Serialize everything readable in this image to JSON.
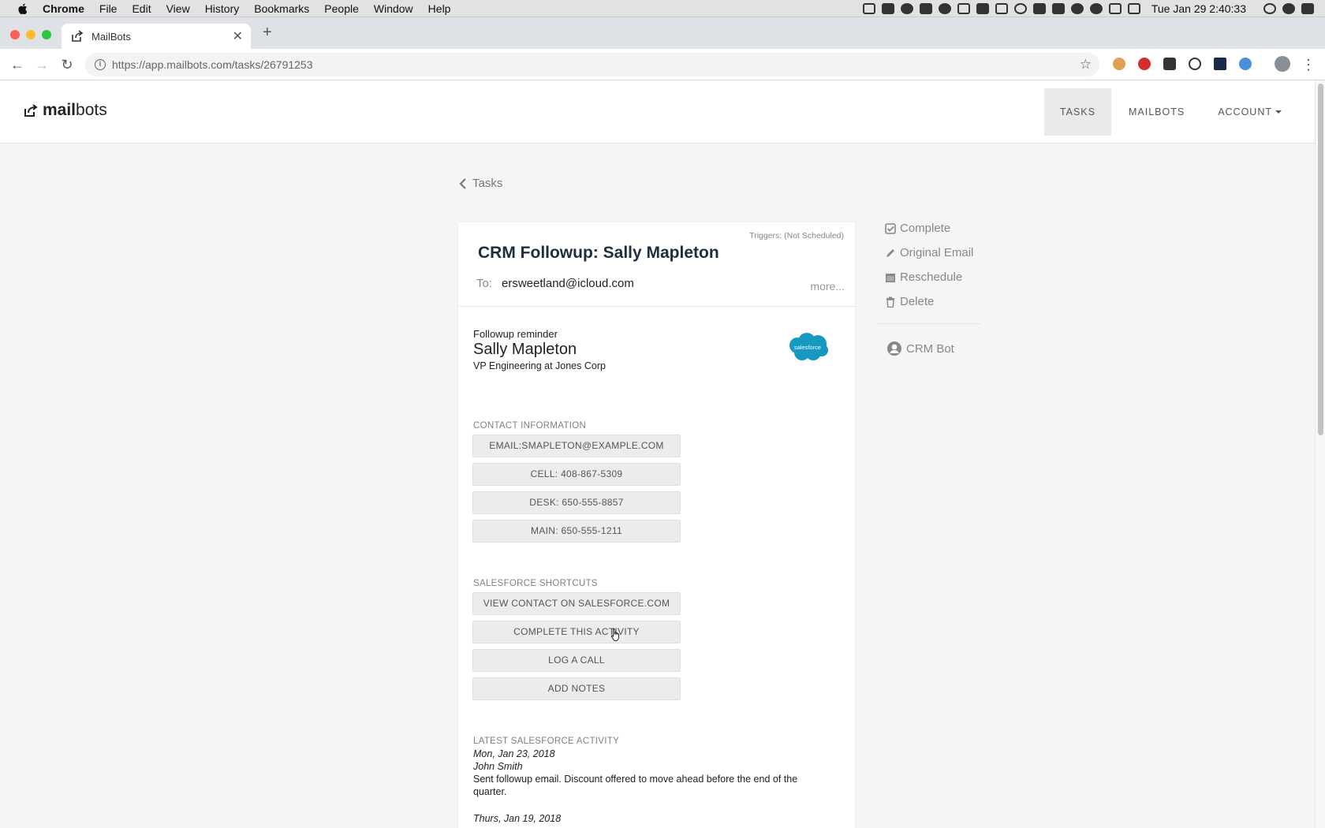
{
  "os_menu": {
    "app": "Chrome",
    "items": [
      "File",
      "Edit",
      "View",
      "History",
      "Bookmarks",
      "People",
      "Window",
      "Help"
    ],
    "clock": "Tue Jan 29  2:40:33"
  },
  "browser": {
    "tab_title": "MailBots",
    "url_host": "https://app.mailbots.com",
    "url_path": "/tasks/26791253"
  },
  "app": {
    "brand_bold": "mail",
    "brand_rest": "bots",
    "nav": {
      "tasks": "TASKS",
      "mailbots": "MAILBOTS",
      "account": "ACCOUNT"
    }
  },
  "breadcrumb": {
    "back_label": "Tasks"
  },
  "task": {
    "triggers": "Triggers: (Not Scheduled)",
    "title": "CRM Followup: Sally Mapleton",
    "to_label": "To:",
    "to_value": "ersweetland@icloud.com",
    "more": "more..."
  },
  "contact": {
    "reminder_label": "Followup reminder",
    "name": "Sally Mapleton",
    "title": "VP Engineering at Jones Corp",
    "logo_text": "salesforce"
  },
  "contact_info": {
    "label": "CONTACT INFORMATION",
    "buttons": [
      "EMAIL:SMAPLETON@EXAMPLE.COM",
      "CELL: 408-867-5309",
      "DESK: 650-555-8857",
      "MAIN: 650-555-1211"
    ]
  },
  "shortcuts": {
    "label": "SALESFORCE SHORTCUTS",
    "buttons": [
      "VIEW CONTACT ON SALESFORCE.COM",
      "COMPLETE THIS ACTIVITY",
      "LOG A CALL",
      "ADD NOTES"
    ]
  },
  "activity": {
    "label": "LATEST SALESFORCE ACTIVITY",
    "entries": [
      {
        "date": "Mon, Jan 23, 2018",
        "name": "John Smith",
        "note": "Sent followup email. Discount offered to move ahead before the end of the quarter."
      },
      {
        "date": "Thurs, Jan 19, 2018"
      }
    ]
  },
  "actions": {
    "complete": "Complete",
    "original_email": "Original Email",
    "reschedule": "Reschedule",
    "delete": "Delete",
    "crm_bot": "CRM Bot"
  },
  "colors": {
    "salesforce_blue": "#1798c1",
    "nav_active_bg": "#e9ebeb",
    "page_bg": "#f4f5f5"
  }
}
